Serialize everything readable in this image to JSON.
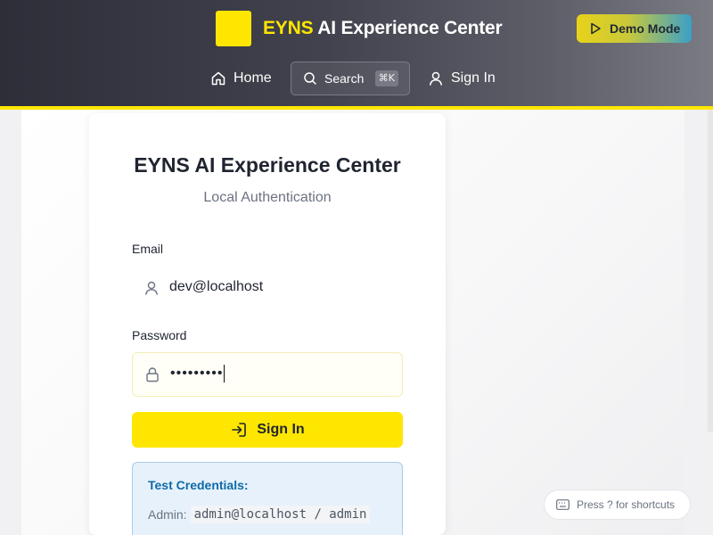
{
  "header": {
    "brand_accent": "EYNS",
    "brand_rest": "AI Experience Center",
    "demo_label": "Demo Mode",
    "nav": {
      "home": "Home",
      "search": "Search",
      "search_kbd": "⌘K",
      "signin": "Sign In"
    }
  },
  "login": {
    "title": "EYNS AI Experience Center",
    "subtitle": "Local Authentication",
    "email_label": "Email",
    "email_value": "dev@localhost",
    "password_label": "Password",
    "password_mask": "•••••••••",
    "submit_label": "Sign In",
    "credentials": {
      "title": "Test Credentials:",
      "admin_label": "Admin:",
      "admin_value": "admin@localhost / admin"
    }
  },
  "shortcut_hint": "Press ? for shortcuts",
  "colors": {
    "accent": "#ffe600",
    "header_dark": "#2d2e38",
    "info_blue": "#0d6aa8"
  },
  "icons": [
    "play-icon",
    "home-icon",
    "search-icon",
    "user-icon",
    "lock-icon",
    "sign-in-icon",
    "keyboard-icon"
  ]
}
